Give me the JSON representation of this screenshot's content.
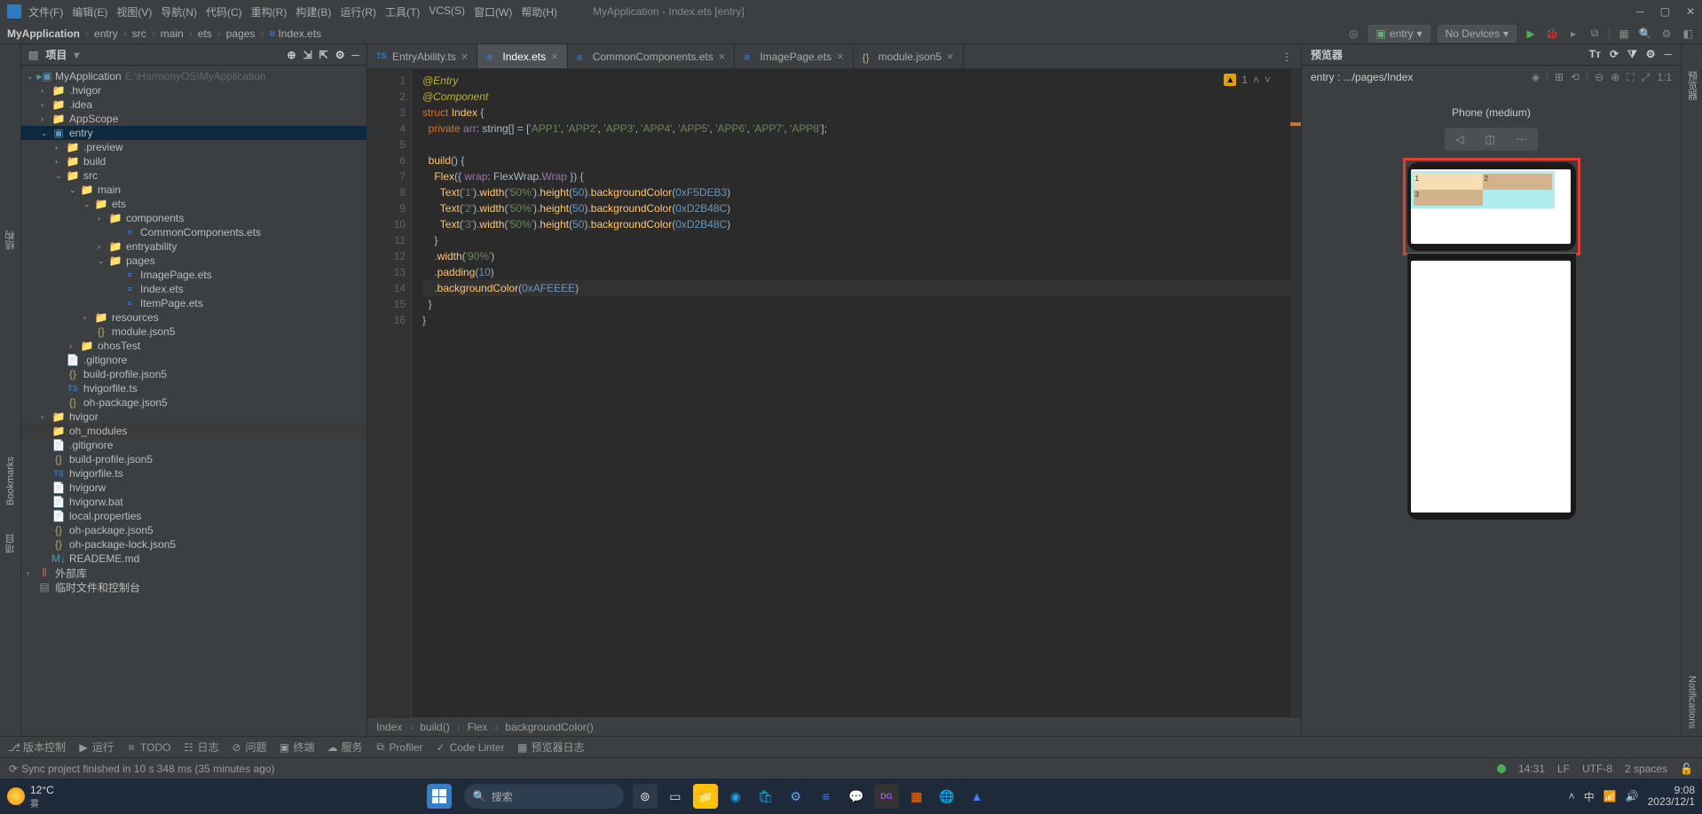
{
  "window": {
    "title": "MyApplication - Index.ets [entry]",
    "menus": [
      "文件(F)",
      "编辑(E)",
      "视图(V)",
      "导航(N)",
      "代码(C)",
      "重构(R)",
      "构建(B)",
      "运行(R)",
      "工具(T)",
      "VCS(S)",
      "窗口(W)",
      "帮助(H)"
    ]
  },
  "nav": {
    "crumbs": [
      "MyApplication",
      "entry",
      "src",
      "main",
      "ets",
      "pages",
      "Index.ets"
    ],
    "runConfig": "entry",
    "device": "No Devices"
  },
  "projectPanel": {
    "title": "项目"
  },
  "tree": [
    {
      "d": 0,
      "a": "v",
      "t": "root",
      "n": "MyApplication",
      "hint": "E:\\HarmonyOS\\MyApplication"
    },
    {
      "d": 1,
      "a": ">",
      "t": "folder",
      "n": ".hvigor"
    },
    {
      "d": 1,
      "a": ">",
      "t": "folder",
      "n": ".idea"
    },
    {
      "d": 1,
      "a": ">",
      "t": "folder",
      "n": "AppScope"
    },
    {
      "d": 1,
      "a": "v",
      "t": "module",
      "n": "entry",
      "sel": true
    },
    {
      "d": 2,
      "a": ">",
      "t": "ofolder",
      "n": ".preview"
    },
    {
      "d": 2,
      "a": ">",
      "t": "ofolder",
      "n": "build"
    },
    {
      "d": 2,
      "a": "v",
      "t": "folder",
      "n": "src"
    },
    {
      "d": 3,
      "a": "v",
      "t": "folder",
      "n": "main"
    },
    {
      "d": 4,
      "a": "v",
      "t": "folder",
      "n": "ets"
    },
    {
      "d": 5,
      "a": ">",
      "t": "folder",
      "n": "components"
    },
    {
      "d": 6,
      "a": "",
      "t": "ets",
      "n": "CommonComponents.ets"
    },
    {
      "d": 5,
      "a": ">",
      "t": "folder",
      "n": "entryability"
    },
    {
      "d": 5,
      "a": "v",
      "t": "folder",
      "n": "pages"
    },
    {
      "d": 6,
      "a": "",
      "t": "ets",
      "n": "ImagePage.ets"
    },
    {
      "d": 6,
      "a": "",
      "t": "ets",
      "n": "Index.ets"
    },
    {
      "d": 6,
      "a": "",
      "t": "ets",
      "n": "ItemPage.ets"
    },
    {
      "d": 4,
      "a": ">",
      "t": "folder",
      "n": "resources"
    },
    {
      "d": 4,
      "a": "",
      "t": "json",
      "n": "module.json5"
    },
    {
      "d": 3,
      "a": ">",
      "t": "folder",
      "n": "ohosTest"
    },
    {
      "d": 2,
      "a": "",
      "t": "file",
      "n": ".gitignore"
    },
    {
      "d": 2,
      "a": "",
      "t": "json",
      "n": "build-profile.json5"
    },
    {
      "d": 2,
      "a": "",
      "t": "ts",
      "n": "hvigorfile.ts"
    },
    {
      "d": 2,
      "a": "",
      "t": "json",
      "n": "oh-package.json5"
    },
    {
      "d": 1,
      "a": ">",
      "t": "folder",
      "n": "hvigor"
    },
    {
      "d": 1,
      "a": "",
      "t": "ofolder",
      "n": "oh_modules",
      "hl": true
    },
    {
      "d": 1,
      "a": "",
      "t": "file",
      "n": ".gitignore"
    },
    {
      "d": 1,
      "a": "",
      "t": "json",
      "n": "build-profile.json5"
    },
    {
      "d": 1,
      "a": "",
      "t": "ts",
      "n": "hvigorfile.ts"
    },
    {
      "d": 1,
      "a": "",
      "t": "file",
      "n": "hvigorw"
    },
    {
      "d": 1,
      "a": "",
      "t": "file",
      "n": "hvigorw.bat"
    },
    {
      "d": 1,
      "a": "",
      "t": "file",
      "n": "local.properties"
    },
    {
      "d": 1,
      "a": "",
      "t": "json",
      "n": "oh-package.json5"
    },
    {
      "d": 1,
      "a": "",
      "t": "json",
      "n": "oh-package-lock.json5"
    },
    {
      "d": 1,
      "a": "",
      "t": "md",
      "n": "READEME.md"
    },
    {
      "d": 0,
      "a": ">",
      "t": "lib",
      "n": "外部库"
    },
    {
      "d": 0,
      "a": "",
      "t": "scratch",
      "n": "临时文件和控制台"
    }
  ],
  "tabs": [
    {
      "name": "EntryAbility.ts",
      "active": false,
      "icon": "ts"
    },
    {
      "name": "Index.ets",
      "active": true,
      "icon": "ets"
    },
    {
      "name": "CommonComponents.ets",
      "active": false,
      "icon": "ets"
    },
    {
      "name": "ImagePage.ets",
      "active": false,
      "icon": "ets"
    },
    {
      "name": "module.json5",
      "active": false,
      "icon": "json"
    }
  ],
  "inspection": {
    "warnings": "1",
    "up": "ˆ",
    "down": "ˇ"
  },
  "codeLines": [
    {
      "n": 1,
      "html": "<span class='ann'>@Entry</span>"
    },
    {
      "n": 2,
      "html": "<span class='ann'>@Component</span>"
    },
    {
      "n": 3,
      "html": "<span class='kw'>struct</span> <span class='ident'>Index</span> {"
    },
    {
      "n": 4,
      "html": "  <span class='kw'>private</span> <span class='prop'>arr</span>: <span class='type'>string</span>[] = [<span class='str'>'APP1'</span>, <span class='str'>'APP2'</span>, <span class='str'>'APP3'</span>, <span class='str'>'APP4'</span>, <span class='str'>'APP5'</span>, <span class='str'>'APP6'</span>, <span class='str'>'APP7'</span>, <span class='str'>'APP8'</span>];"
    },
    {
      "n": 5,
      "html": ""
    },
    {
      "n": 6,
      "html": "  <span class='ident'>build</span>() {"
    },
    {
      "n": 7,
      "html": "    <span class='ident'>Flex</span>({ <span class='prop'>wrap</span>: FlexWrap.<span class='prop'>Wrap</span> }) {"
    },
    {
      "n": 8,
      "html": "      <span class='ident'>Text</span>(<span class='str'>'1'</span>).<span class='ident'>width</span>(<span class='str'>'50%'</span>).<span class='ident'>height</span>(<span class='num'>50</span>).<span class='ident'>backgroundColor</span>(<span class='num'>0xF5DEB3</span>)"
    },
    {
      "n": 9,
      "html": "      <span class='ident'>Text</span>(<span class='str'>'2'</span>).<span class='ident'>width</span>(<span class='str'>'50%'</span>).<span class='ident'>height</span>(<span class='num'>50</span>).<span class='ident'>backgroundColor</span>(<span class='num'>0xD2B48C</span>)"
    },
    {
      "n": 10,
      "html": "      <span class='ident'>Text</span>(<span class='str'>'3'</span>).<span class='ident'>width</span>(<span class='str'>'50%'</span>).<span class='ident'>height</span>(<span class='num'>50</span>).<span class='ident'>backgroundColor</span>(<span class='num'>0xD2B48C</span>)"
    },
    {
      "n": 11,
      "html": "    }"
    },
    {
      "n": 12,
      "html": "    .<span class='ident'>width</span>(<span class='str'>'90%'</span>)"
    },
    {
      "n": 13,
      "html": "    .<span class='ident'>padding</span>(<span class='num'>10</span>)"
    },
    {
      "n": 14,
      "html": "    .<span class='ident'>backgroundColor</span>(<span class='num'>0xAFEEEE</span>)<span class='caret'> </span>",
      "caret": true
    },
    {
      "n": 15,
      "html": "  }"
    },
    {
      "n": 16,
      "html": "}"
    }
  ],
  "bottomCrumbs": [
    "Index",
    "build()",
    "Flex",
    "backgroundColor()"
  ],
  "previewer": {
    "title": "预览器",
    "path": "entry : .../pages/Index",
    "device": "Phone (medium)",
    "cells": [
      "1",
      "2",
      "3"
    ]
  },
  "toolButtons": [
    {
      "icon": "⎇",
      "label": "版本控制"
    },
    {
      "icon": "▶",
      "label": "运行"
    },
    {
      "icon": "≡",
      "label": "TODO"
    },
    {
      "icon": "☷",
      "label": "日志"
    },
    {
      "icon": "⊘",
      "label": "问题"
    },
    {
      "icon": "▣",
      "label": "终端"
    },
    {
      "icon": "☁",
      "label": "服务"
    },
    {
      "icon": "⧉",
      "label": "Profiler"
    },
    {
      "icon": "✓",
      "label": "Code Linter"
    },
    {
      "icon": "▦",
      "label": "预览器日志"
    }
  ],
  "status": {
    "msg": "Sync project finished in 10 s 348 ms (35 minutes ago)",
    "time": "14:31",
    "lf": "LF",
    "enc": "UTF-8",
    "indent": "2 spaces"
  },
  "taskbar": {
    "temp": "12°C",
    "weather": "雾",
    "search": "搜索",
    "clock": {
      "time": "9:08",
      "date": "2023/12/1"
    }
  },
  "sidebarLeft": [
    "项目",
    "Bookmarks",
    "结构"
  ],
  "sidebarRight": [
    "Notifications",
    "预览器"
  ]
}
